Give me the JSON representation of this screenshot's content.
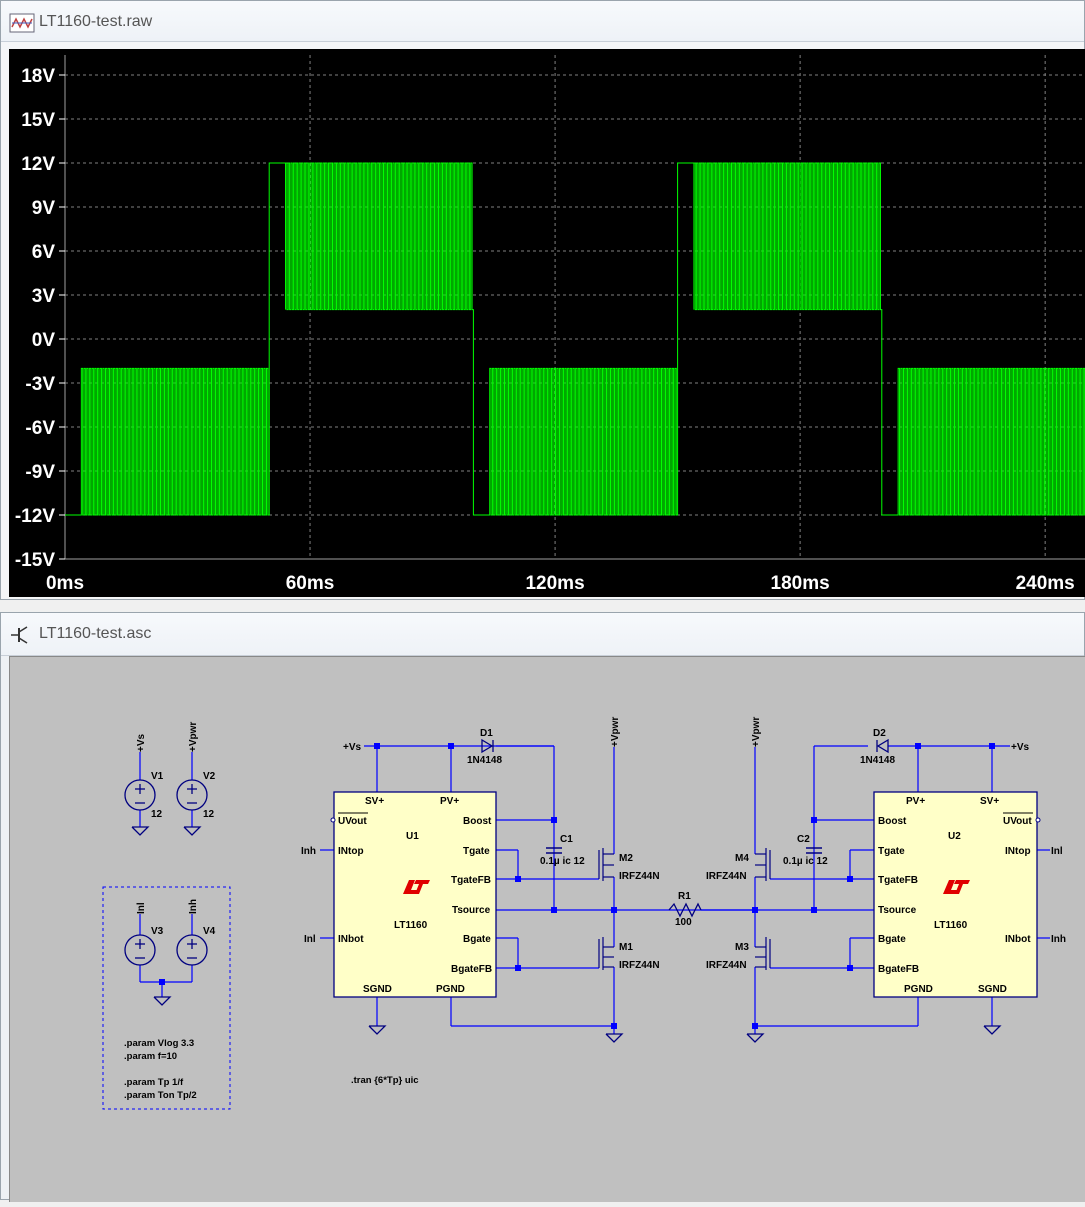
{
  "waveform_window": {
    "title": "LT1160-test.raw",
    "icon": "waveform-viewer-icon"
  },
  "schematic_window": {
    "title": "LT1160-test.asc",
    "icon": "transistor-icon"
  },
  "chart_data": {
    "type": "line",
    "title": "",
    "xlabel": "",
    "ylabel": "",
    "xlim": [
      0,
      250
    ],
    "ylim": [
      -15,
      18
    ],
    "x_ticks": [
      "0ms",
      "60ms",
      "120ms",
      "180ms",
      "240ms"
    ],
    "x_tick_values": [
      0,
      60,
      120,
      180,
      240
    ],
    "y_ticks": [
      "18V",
      "15V",
      "12V",
      "9V",
      "6V",
      "3V",
      "0V",
      "-3V",
      "-6V",
      "-9V",
      "-12V",
      "-15V"
    ],
    "y_tick_values": [
      18,
      15,
      12,
      9,
      6,
      3,
      0,
      -3,
      -6,
      -9,
      -12,
      -15
    ],
    "grid": true,
    "trace_color": "#00ff00",
    "background": "#000000",
    "series": [
      {
        "segments": [
          {
            "t0": 0,
            "t1": 4,
            "level": -12
          },
          {
            "t0": 4,
            "t1": 50,
            "pwm_low": -12,
            "pwm_high": -2
          },
          {
            "t0": 50,
            "t1": 54,
            "level": 12
          },
          {
            "t0": 54,
            "t1": 100,
            "pwm_low": 2,
            "pwm_high": 12
          },
          {
            "t0": 100,
            "t1": 104,
            "level": -12
          },
          {
            "t0": 104,
            "t1": 150,
            "pwm_low": -12,
            "pwm_high": -2
          },
          {
            "t0": 150,
            "t1": 154,
            "level": 12
          },
          {
            "t0": 154,
            "t1": 200,
            "pwm_low": 2,
            "pwm_high": 12
          },
          {
            "t0": 200,
            "t1": 204,
            "level": -12
          },
          {
            "t0": 204,
            "t1": 250,
            "pwm_low": -12,
            "pwm_high": -2
          }
        ]
      }
    ]
  },
  "schematic": {
    "sources": {
      "v1": {
        "name": "V1",
        "value": "12",
        "net": "+Vs"
      },
      "v2": {
        "name": "V2",
        "value": "12",
        "net": "+Vpwr"
      },
      "v3": {
        "name": "V3",
        "net": "Inl"
      },
      "v4": {
        "name": "V4",
        "net": "Inh"
      }
    },
    "directives": {
      "param1": ".param Vlog  3.3",
      "param2": ".param f=10",
      "param3": ".param Tp 1/f",
      "param4": ".param Ton Tp/2",
      "tran": ".tran {6*Tp} uic"
    },
    "u1": {
      "name": "U1",
      "part": "LT1160",
      "pins": {
        "svp": "SV+",
        "pvp": "PV+",
        "uvout": "UVout",
        "boost": "Boost",
        "intop": "INtop",
        "tgate": "Tgate",
        "tgatefb": "TgateFB",
        "tsource": "Tsource",
        "inbot": "INbot",
        "bgate": "Bgate",
        "bgatefb": "BgateFB",
        "sgnd": "SGND",
        "pgnd": "PGND"
      }
    },
    "u2": {
      "name": "U2",
      "part": "LT1160",
      "pins": {
        "pvp": "PV+",
        "svp": "SV+",
        "boost": "Boost",
        "uvout": "UVout",
        "tgate": "Tgate",
        "intop": "INtop",
        "tgatefb": "TgateFB",
        "tsource": "Tsource",
        "bgate": "Bgate",
        "inbot": "INbot",
        "bgatefb": "BgateFB",
        "pgnd": "PGND",
        "sgnd": "SGND"
      }
    },
    "nets": {
      "vs": "+Vs",
      "vpwr": "+Vpwr",
      "inh": "Inh",
      "inl": "Inl"
    },
    "d1": {
      "name": "D1",
      "value": "1N4148"
    },
    "d2": {
      "name": "D2",
      "value": "1N4148"
    },
    "c1": {
      "name": "C1",
      "value": "0.1µ ic 12"
    },
    "c2": {
      "name": "C2",
      "value": "0.1µ ic 12"
    },
    "m1": {
      "name": "M1",
      "value": "IRFZ44N"
    },
    "m2": {
      "name": "M2",
      "value": "IRFZ44N"
    },
    "m3": {
      "name": "M3",
      "value": "IRFZ44N"
    },
    "m4": {
      "name": "M4",
      "value": "IRFZ44N"
    },
    "r1": {
      "name": "R1",
      "value": "100"
    },
    "colors": {
      "wire": "#0000ff",
      "component": "#000080",
      "ic_fill": "#ffffc8",
      "logo": "#e00000"
    }
  }
}
